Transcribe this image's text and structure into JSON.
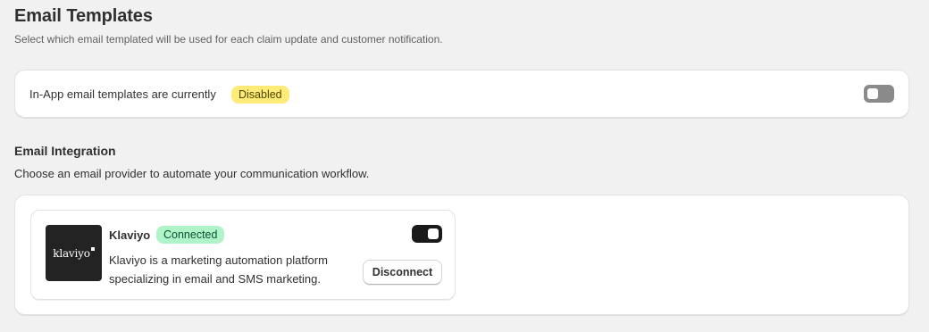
{
  "header": {
    "title": "Email Templates",
    "subtitle": "Select which email templated will be used for each claim update and customer notification."
  },
  "in_app": {
    "status_text": "In-App email templates are currently",
    "status_badge": "Disabled",
    "toggle_state": "off"
  },
  "integration": {
    "title": "Email Integration",
    "subtitle": "Choose an email provider to automate your communication workflow.",
    "provider": {
      "logo_text": "klaviyo",
      "name": "Klaviyo",
      "status_badge": "Connected",
      "description": "Klaviyo is a marketing automation platform specializing in email and SMS marketing.",
      "toggle_state": "on",
      "disconnect_label": "Disconnect"
    }
  },
  "colors": {
    "background": "#f1f1f1",
    "disabled_badge": "#ffeb78",
    "connected_badge": "#aff3c8",
    "toggle_off": "#8a8a8a",
    "toggle_on": "#1a1a1a"
  }
}
